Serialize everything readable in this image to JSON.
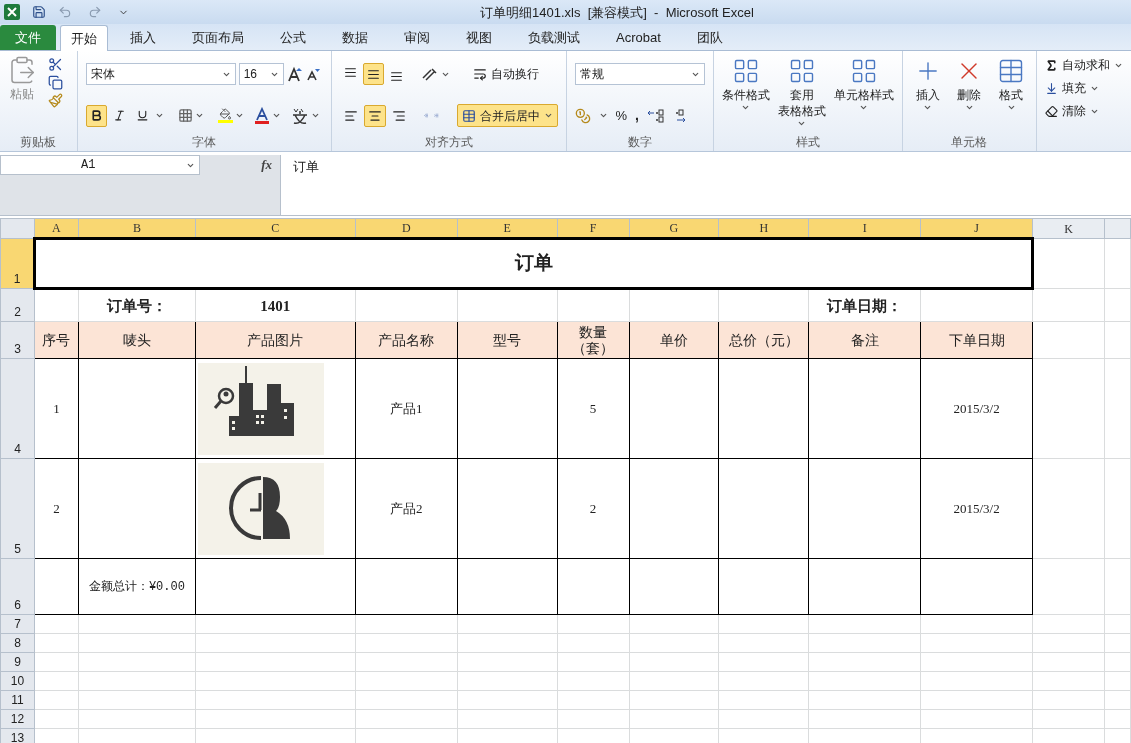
{
  "window": {
    "title": "订单明细1401.xls  [兼容模式]  -  Microsoft Excel"
  },
  "file_tab": "文件",
  "tabs": [
    {
      "label": "开始",
      "selected": true
    },
    {
      "label": "插入",
      "selected": false
    },
    {
      "label": "页面布局",
      "selected": false
    },
    {
      "label": "公式",
      "selected": false
    },
    {
      "label": "数据",
      "selected": false
    },
    {
      "label": "审阅",
      "selected": false
    },
    {
      "label": "视图",
      "selected": false
    },
    {
      "label": "负载测试",
      "selected": false
    },
    {
      "label": "Acrobat",
      "selected": false
    },
    {
      "label": "团队",
      "selected": false
    }
  ],
  "ribbon": {
    "clipboard": {
      "label": "剪贴板",
      "paste": "粘贴"
    },
    "font": {
      "label": "字体",
      "font_name": "宋体",
      "font_size": "16",
      "bold": true,
      "italic": false,
      "underline": false
    },
    "alignment": {
      "label": "对齐方式",
      "vertical_buttons": [
        {
          "selected": false
        },
        {
          "selected": true
        },
        {
          "selected": false
        }
      ],
      "horizontal_buttons": [
        {
          "selected": false
        },
        {
          "selected": true
        },
        {
          "selected": false
        }
      ],
      "wrap_text": "自动换行",
      "wrap_on": false,
      "merge_center": "合并后居中",
      "merged": true
    },
    "number": {
      "label": "数字",
      "format": "常规",
      "percent": "%",
      "comma": ","
    },
    "styles": {
      "label": "样式",
      "buttons": [
        {
          "lines": [
            "条件格式"
          ]
        },
        {
          "lines": [
            "套用",
            "表格格式"
          ]
        },
        {
          "lines": [
            "单元格样式"
          ]
        }
      ]
    },
    "cells": {
      "label": "单元格",
      "buttons": [
        "插入",
        "删除",
        "格式"
      ]
    },
    "editing": {
      "buttons": [
        "自动求和",
        "填充",
        "清除"
      ]
    }
  },
  "formula_bar": {
    "name_box": "A1",
    "fx": "fx",
    "content": "订单"
  },
  "sheet": {
    "columns": [
      {
        "letter": "A",
        "selected": true
      },
      {
        "letter": "B",
        "selected": true
      },
      {
        "letter": "C",
        "selected": true
      },
      {
        "letter": "D",
        "selected": true
      },
      {
        "letter": "E",
        "selected": true
      },
      {
        "letter": "F",
        "selected": true
      },
      {
        "letter": "G",
        "selected": true
      },
      {
        "letter": "H",
        "selected": true
      },
      {
        "letter": "I",
        "selected": true
      },
      {
        "letter": "J",
        "selected": true
      },
      {
        "letter": "K",
        "selected": false
      }
    ],
    "rows": [
      {
        "number": "1",
        "kind": "title",
        "selected": true,
        "text": "订单"
      },
      {
        "number": "2",
        "kind": "info",
        "selected": false,
        "cells": [
          {},
          {
            "text": "订单号：",
            "bold": true
          },
          {
            "text": "1401",
            "bold": true
          },
          {},
          {},
          {},
          {},
          {},
          {
            "text": "订单日期：",
            "bold": true
          },
          {}
        ]
      },
      {
        "number": "3",
        "kind": "header",
        "selected": false,
        "cells": [
          {
            "text": "序号"
          },
          {
            "text": "唛头"
          },
          {
            "text": "产品图片"
          },
          {
            "text": "产品名称"
          },
          {
            "text": "型号"
          },
          {
            "lines": [
              "数量",
              "（套）"
            ]
          },
          {
            "text": "单价"
          },
          {
            "text": "总价（元）"
          },
          {
            "text": "备注"
          },
          {
            "text": "下单日期"
          }
        ]
      },
      {
        "number": "4",
        "kind": "item",
        "selected": false,
        "cells": [
          {
            "text": "1"
          },
          {},
          {
            "kind": "city_picture"
          },
          {
            "text": "产品1"
          },
          {},
          {
            "text": "5"
          },
          {},
          {},
          {},
          {
            "text": "2015/3/2"
          }
        ]
      },
      {
        "number": "5",
        "kind": "item",
        "selected": false,
        "cells": [
          {
            "text": "2"
          },
          {},
          {
            "kind": "clock_picture"
          },
          {
            "text": "产品2"
          },
          {},
          {
            "text": "2"
          },
          {},
          {},
          {},
          {
            "text": "2015/3/2"
          }
        ]
      },
      {
        "number": "6",
        "kind": "total",
        "selected": false,
        "cells": [
          {},
          {
            "text": "金额总计：¥0.00"
          },
          {},
          {},
          {},
          {},
          {},
          {},
          {},
          {}
        ]
      },
      {
        "number": "7",
        "kind": "blank",
        "selected": false
      },
      {
        "number": "8",
        "kind": "blank",
        "selected": false
      },
      {
        "number": "9",
        "kind": "blank",
        "selected": false
      },
      {
        "number": "10",
        "kind": "blank",
        "selected": false
      },
      {
        "number": "11",
        "kind": "blank",
        "selected": false
      },
      {
        "number": "12",
        "kind": "blank",
        "selected": false
      },
      {
        "number": "13",
        "kind": "blank",
        "selected": false
      }
    ]
  }
}
